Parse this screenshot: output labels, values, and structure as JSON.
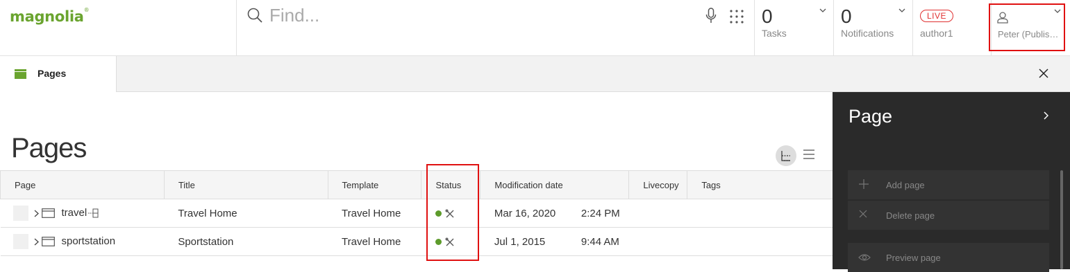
{
  "header": {
    "logo": "magnolia",
    "logo_mark": "®",
    "search": {
      "placeholder": "Find..."
    },
    "tasks": {
      "count": "0",
      "label": "Tasks"
    },
    "notifications": {
      "count": "0",
      "label": "Notifications"
    },
    "environment": {
      "badge": "LIVE",
      "instance": "author1"
    },
    "user": {
      "name": "Peter (Publish..."
    }
  },
  "tabs": [
    {
      "label": "Pages"
    }
  ],
  "main": {
    "title": "Pages",
    "columns": [
      "Page",
      "Title",
      "Template",
      "Status",
      "Modification date",
      "Livecopy",
      "Tags"
    ],
    "rows": [
      {
        "page": "travel",
        "title": "Travel Home",
        "template": "Travel Home",
        "date": "Mar 16, 2020",
        "time": "2:24 PM",
        "livecopy": "",
        "tags": ""
      },
      {
        "page": "sportstation",
        "title": "Sportstation",
        "template": "Travel Home",
        "date": "Jul 1, 2015",
        "time": "9:44 AM",
        "livecopy": "",
        "tags": ""
      }
    ]
  },
  "action_bar": {
    "title": "Page",
    "items": [
      {
        "label": "Add page",
        "icon": "plus-icon"
      },
      {
        "label": "Delete page",
        "icon": "close-icon"
      },
      {
        "label": "Preview page",
        "icon": "eye-icon"
      }
    ]
  },
  "colors": {
    "brand": "#6aa42f",
    "live": "#e03030",
    "status_published": "#5d9b2b",
    "action_bar": "#2a2a2a"
  }
}
